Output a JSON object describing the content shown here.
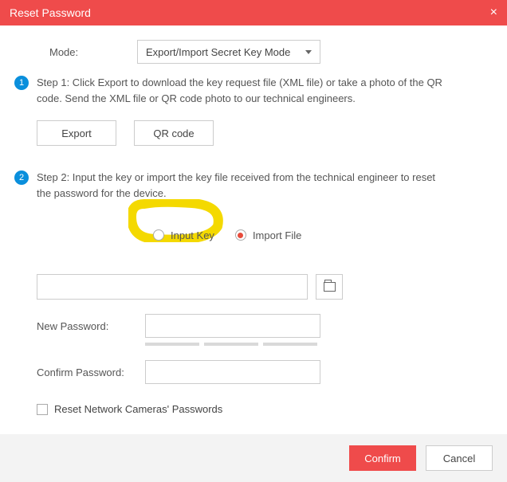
{
  "titlebar": {
    "title": "Reset Password"
  },
  "mode": {
    "label": "Mode:",
    "selected": "Export/Import Secret Key Mode"
  },
  "step1": {
    "num": "1",
    "text": "Step 1: Click Export to download the key request file (XML file) or take a photo of the QR code. Send the XML file or QR code photo to our technical engineers.",
    "export_btn": "Export",
    "qr_btn": "QR code"
  },
  "step2": {
    "num": "2",
    "text": "Step 2: Input the key or import the key file received from the technical engineer to reset the password for the device.",
    "option_input_key": "Input Key",
    "option_import_file": "Import File",
    "file_path": "",
    "new_password_label": "New Password:",
    "new_password_value": "",
    "confirm_password_label": "Confirm Password:",
    "confirm_password_value": "",
    "reset_cameras_label": "Reset Network Cameras' Passwords"
  },
  "footer": {
    "confirm": "Confirm",
    "cancel": "Cancel"
  }
}
